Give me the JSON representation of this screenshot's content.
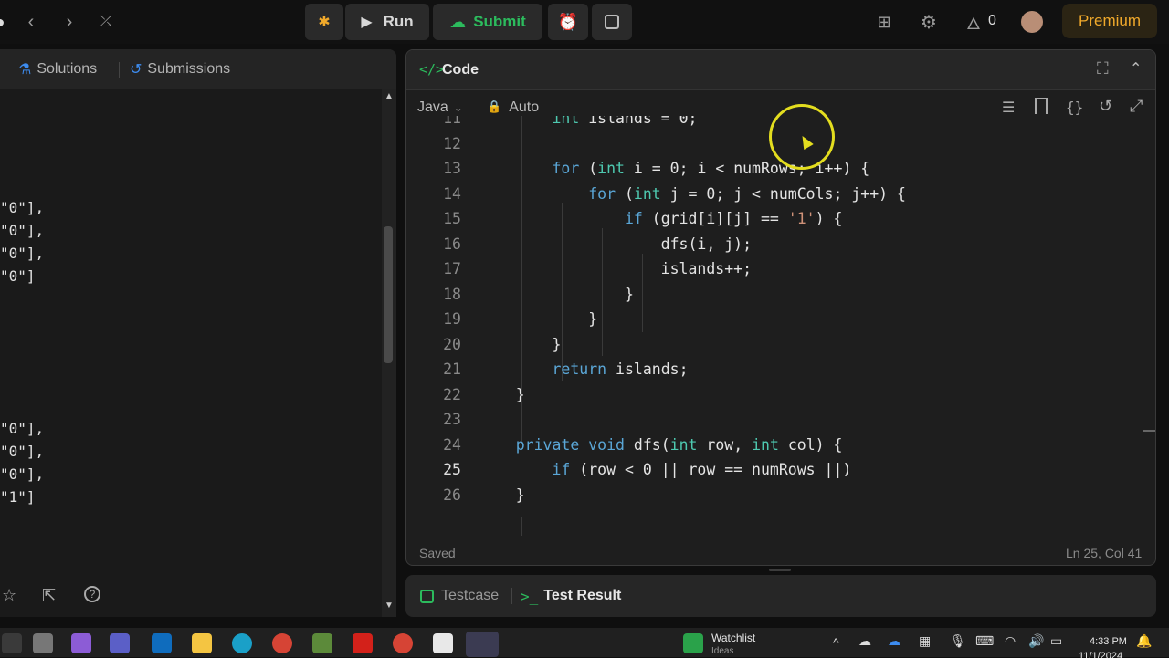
{
  "topbar": {
    "run_label": "Run",
    "submit_label": "Submit",
    "streak_count": "0",
    "premium_label": "Premium"
  },
  "left_panel": {
    "tabs": [
      {
        "label": "Solutions"
      },
      {
        "label": "Submissions"
      }
    ],
    "json_lines_top": [
      "\"0\"],",
      "\"0\"],",
      "\"0\"],",
      "\"0\"]"
    ],
    "json_lines_bottom": [
      "\"0\"],",
      "\"0\"],",
      "\"0\"],",
      "\"1\"]"
    ]
  },
  "code_panel": {
    "title": "Code",
    "language": "Java",
    "mode": "Auto",
    "status_left": "Saved",
    "status_right": "Ln 25, Col 41",
    "lines": [
      {
        "n": "11",
        "code": "        int islands = 0;"
      },
      {
        "n": "12",
        "code": ""
      },
      {
        "n": "13",
        "code": "        for (int i = 0; i < numRows; i++) {"
      },
      {
        "n": "14",
        "code": "            for (int j = 0; j < numCols; j++) {"
      },
      {
        "n": "15",
        "code": "                if (grid[i][j] == '1') {"
      },
      {
        "n": "16",
        "code": "                    dfs(i, j);"
      },
      {
        "n": "17",
        "code": "                    islands++;"
      },
      {
        "n": "18",
        "code": "                }"
      },
      {
        "n": "19",
        "code": "            }"
      },
      {
        "n": "20",
        "code": "        }"
      },
      {
        "n": "21",
        "code": "        return islands;"
      },
      {
        "n": "22",
        "code": "    }"
      },
      {
        "n": "23",
        "code": ""
      },
      {
        "n": "24",
        "code": "    private void dfs(int row, int col) {"
      },
      {
        "n": "25",
        "code": "        if (row < 0 || row == numRows ||)"
      },
      {
        "n": "26",
        "code": "    }"
      }
    ]
  },
  "bottom_panel": {
    "tab_testcase": "Testcase",
    "tab_result": "Test Result"
  },
  "taskbar": {
    "widget_title": "Watchlist",
    "widget_sub": "Ideas",
    "time": "4:33 PM",
    "date": "11/1/2024"
  }
}
